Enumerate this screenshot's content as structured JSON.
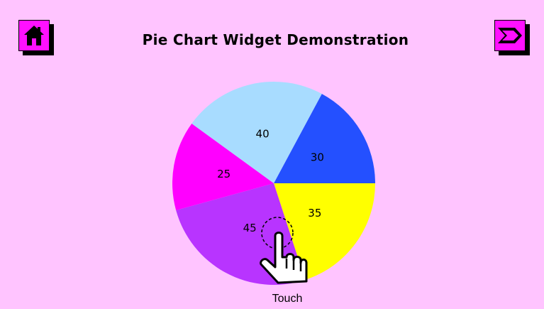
{
  "header": {
    "title": "Pie Chart Widget Demonstration",
    "home_icon": "home-icon",
    "next_icon": "next-arrow-icon"
  },
  "colors": {
    "background": "#ffc4ff",
    "button_face": "#ff10ff"
  },
  "touch_hint": {
    "label": "Touch",
    "icon": "pointing-hand-icon"
  },
  "chart_data": {
    "type": "pie",
    "title": "",
    "slices": [
      {
        "value": 30,
        "color": "#2450ff"
      },
      {
        "value": 35,
        "color": "#ffff00"
      },
      {
        "value": 45,
        "color": "#b834ff"
      },
      {
        "value": 25,
        "color": "#ff00ff"
      },
      {
        "value": 40,
        "color": "#a8dcff"
      }
    ],
    "labels_shown": true,
    "start": "3 o'clock",
    "direction": "counterclockwise from 3 o'clock for first slice"
  }
}
